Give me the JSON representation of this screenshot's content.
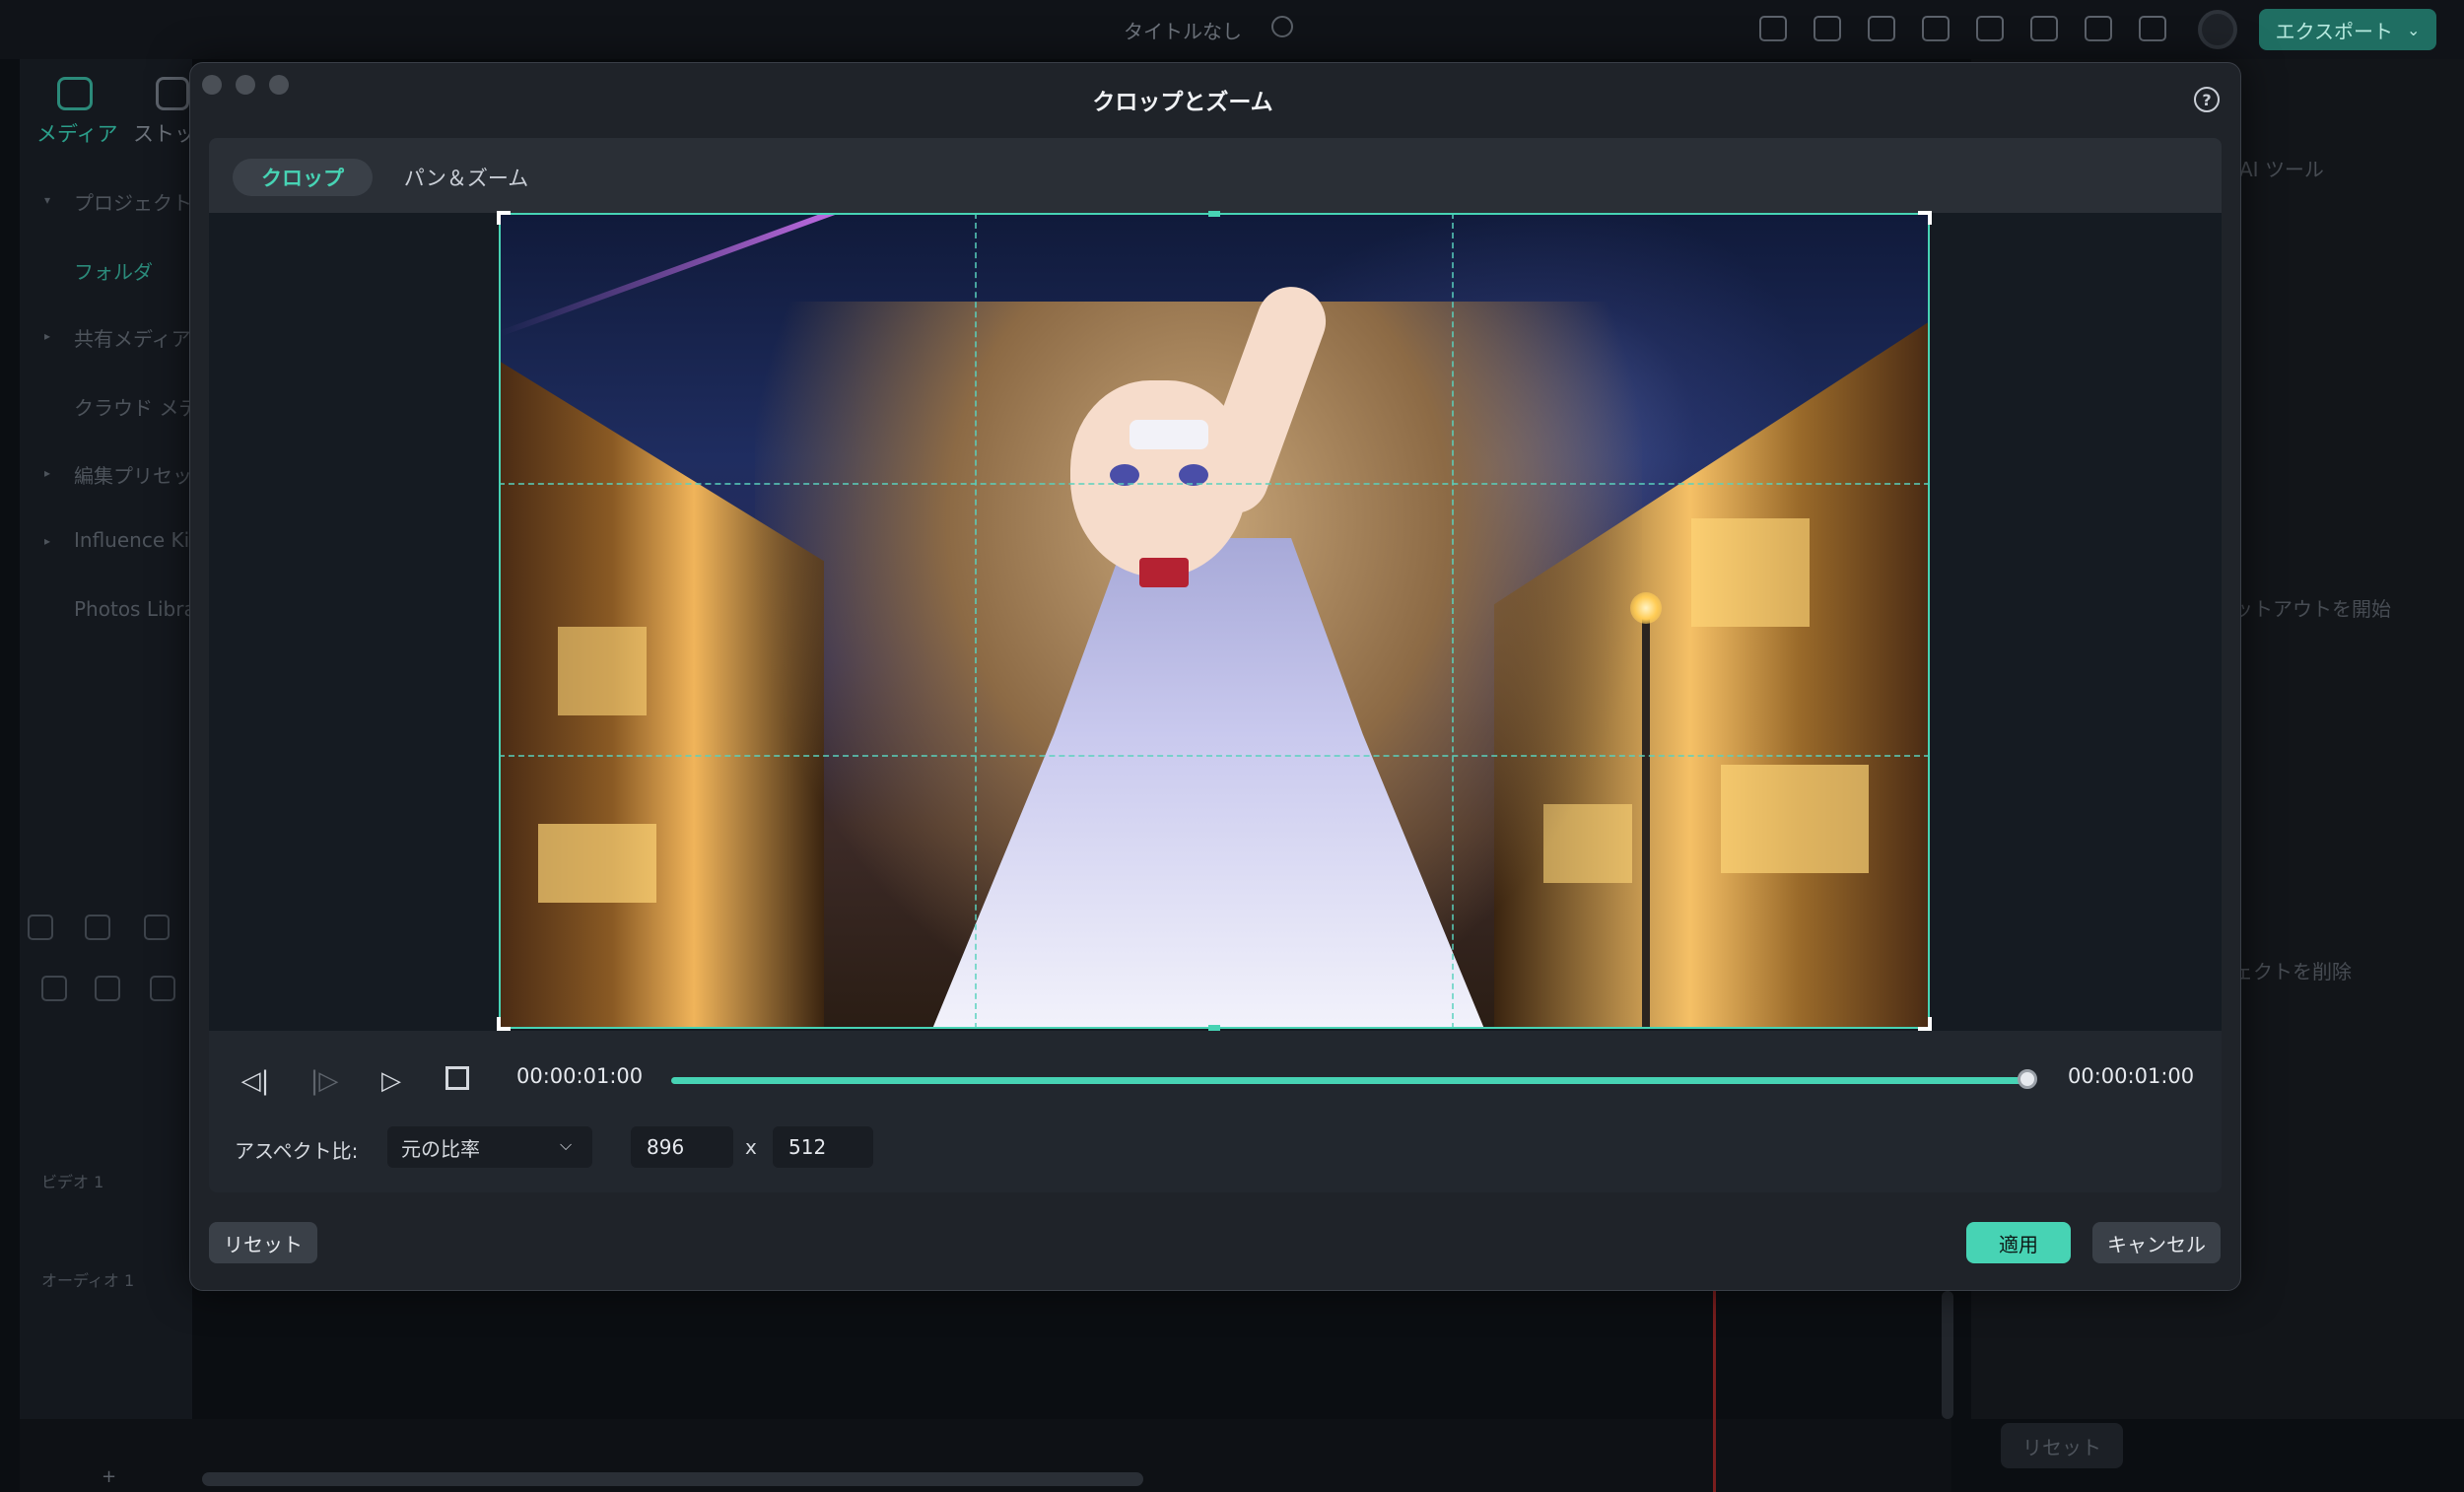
{
  "app": {
    "title": "タイトルなし",
    "export_label": "エクスポート",
    "export_chevron": "⌄",
    "left_tabs": [
      {
        "label": "メディア",
        "icon": "media-icon"
      },
      {
        "label": "ストッ",
        "icon": "stock-icon"
      }
    ],
    "left_items": [
      "プロジェクト",
      "フォルダ",
      "共有メディア",
      "クラウド メデ",
      "編集プリセッ",
      "Influence Ki",
      "Photos Libra"
    ],
    "tracks": [
      "ビデオ 1",
      "オーディオ 1"
    ],
    "right_panel": {
      "ai_tools": "AI ツール",
      "cutout_start": "ットアウトを開始",
      "delete_effect": "ェクトを削除",
      "reset": "リセット"
    },
    "add_symbol": "+"
  },
  "dialog": {
    "title": "クロップとズーム",
    "help": "?",
    "tabs": [
      {
        "label": "クロップ",
        "active": true
      },
      {
        "label": "パン＆ズーム",
        "active": false
      }
    ],
    "player": {
      "current_time": "00:00:01:00",
      "total_time": "00:00:01:00",
      "progress": 1.0,
      "icons": [
        "prev-frame-icon",
        "next-frame-icon",
        "play-icon",
        "stop-icon"
      ]
    },
    "aspect": {
      "label": "アスペクト比:",
      "value": "元の比率",
      "width": "896",
      "times": "x",
      "height": "512"
    },
    "buttons": {
      "reset": "リセット",
      "apply": "適用",
      "cancel": "キャンセル"
    }
  },
  "colors": {
    "accent": "#47d3b4",
    "modal_bg": "#1f2329",
    "app_bg": "#0b0e12"
  }
}
